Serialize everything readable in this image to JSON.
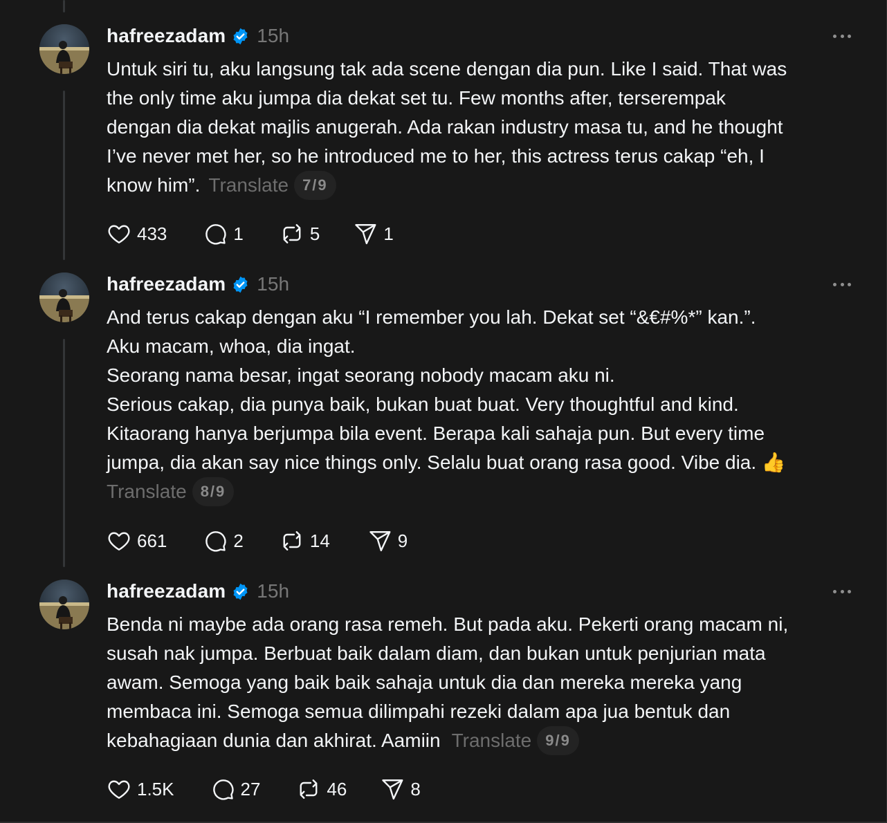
{
  "posts": [
    {
      "username": "hafreezadam",
      "time": "15h",
      "lines": [
        "Untuk siri tu, aku langsung tak ada scene dengan dia pun. Like I said. That was",
        "the only time aku jumpa dia dekat set tu. Few months after, terserempak",
        "dengan dia dekat majlis anugerah. Ada rakan industry masa tu, and he thought",
        "I’ve never met her, so he introduced me to her, this actress terus cakap “eh, I"
      ],
      "last_line": "know him”.",
      "translate_label": "Translate",
      "counter": "7/9",
      "likes": "433",
      "replies": "1",
      "reposts": "5",
      "shares": "1"
    },
    {
      "username": "hafreezadam",
      "time": "15h",
      "lines": [
        "And terus cakap dengan aku “I remember you lah. Dekat set “&€#%*” kan.”.",
        "Aku macam, whoa, dia ingat.",
        "Seorang nama besar, ingat seorang nobody macam aku ni.",
        "Serious cakap, dia punya baik, bukan buat buat. Very thoughtful and kind.",
        "Kitaorang hanya berjumpa bila event. Berapa kali sahaja pun. But every time",
        "jumpa, dia akan say nice things only. Selalu buat orang rasa good. Vibe dia. 👍"
      ],
      "last_line": "",
      "translate_label": "Translate",
      "counter": "8/9",
      "likes": "661",
      "replies": "2",
      "reposts": "14",
      "shares": "9"
    },
    {
      "username": "hafreezadam",
      "time": "15h",
      "lines": [
        "Benda ni maybe ada orang rasa remeh. But pada aku. Pekerti orang macam ni,",
        "susah nak jumpa. Berbuat baik dalam diam, dan bukan untuk penjurian mata",
        "awam. Semoga yang baik baik sahaja untuk dia dan mereka mereka yang",
        "membaca ini. Semoga semua dilimpahi rezeki dalam apa jua bentuk dan"
      ],
      "last_line": "kebahagiaan dunia dan akhirat. Aamiin",
      "translate_label": "Translate",
      "counter": "9/9",
      "likes": "1.5K",
      "replies": "27",
      "reposts": "46",
      "shares": "8"
    }
  ],
  "icons": {
    "like": "heart-icon",
    "reply": "comment-icon",
    "repost": "repost-icon",
    "share": "send-icon",
    "verified": "verified-badge-icon",
    "more": "more-options-icon"
  },
  "colors": {
    "background": "#181818",
    "text": "#f3f5f7",
    "muted": "#777777",
    "verified": "#0095f6"
  }
}
